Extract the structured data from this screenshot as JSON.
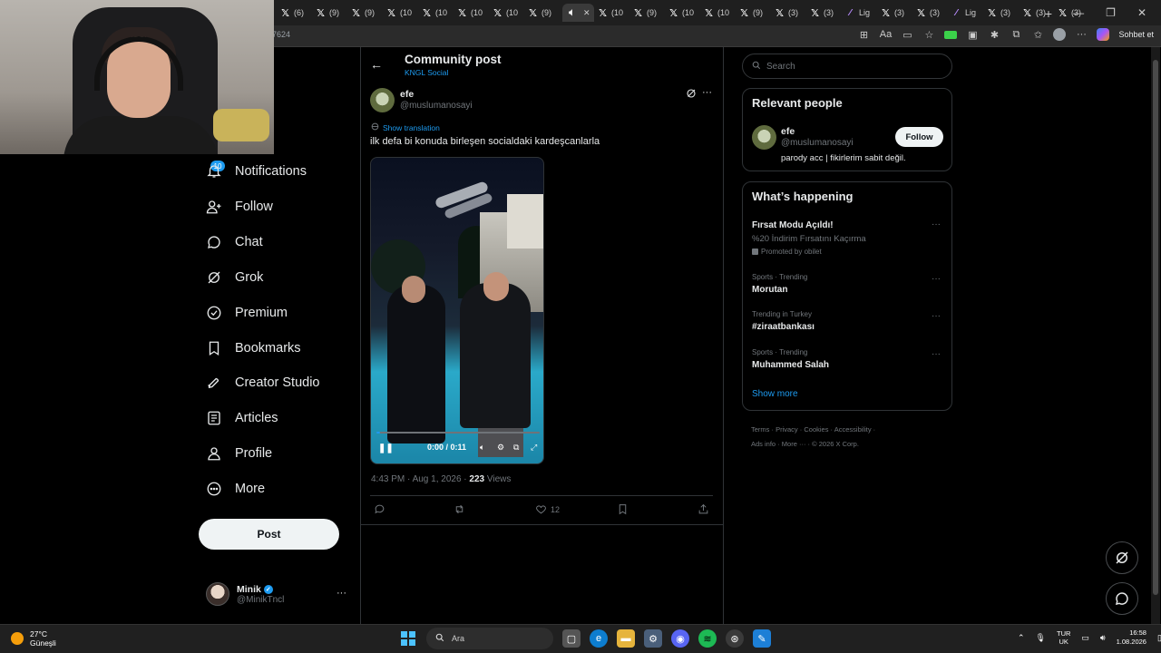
{
  "browser": {
    "tabs": [
      {
        "label": "(6)",
        "active": false
      },
      {
        "label": "(9)",
        "active": false
      },
      {
        "label": "(9)",
        "active": false
      },
      {
        "label": "(10",
        "active": false
      },
      {
        "label": "(10",
        "active": false
      },
      {
        "label": "(10",
        "active": false
      },
      {
        "label": "(10",
        "active": false
      },
      {
        "label": "(9)",
        "active": false
      },
      {
        "label": "",
        "active": true
      },
      {
        "label": "(10",
        "active": false
      },
      {
        "label": "(9)",
        "active": false
      },
      {
        "label": "(10",
        "active": false
      },
      {
        "label": "(10",
        "active": false
      },
      {
        "label": "(9)",
        "active": false
      },
      {
        "label": "(3)",
        "active": false
      },
      {
        "label": "(3)",
        "active": false
      },
      {
        "label": "Lig",
        "active": false
      },
      {
        "label": "(3)",
        "active": false
      },
      {
        "label": "(3)",
        "active": false
      },
      {
        "label": "Lig",
        "active": false
      },
      {
        "label": "(3)",
        "active": false
      },
      {
        "label": "(3)",
        "active": false
      },
      {
        "label": "(3)",
        "active": false
      }
    ],
    "url_fragment": "7624",
    "copilot_label": "Sohbet et"
  },
  "nav": {
    "notifications_badge": "10",
    "items": [
      {
        "label": "Notifications",
        "icon": "bell-icon"
      },
      {
        "label": "Follow",
        "icon": "person-add-icon"
      },
      {
        "label": "Chat",
        "icon": "chat-icon"
      },
      {
        "label": "Grok",
        "icon": "grok-icon"
      },
      {
        "label": "Premium",
        "icon": "premium-icon"
      },
      {
        "label": "Bookmarks",
        "icon": "bookmark-icon"
      },
      {
        "label": "Creator Studio",
        "icon": "rocket-icon"
      },
      {
        "label": "Articles",
        "icon": "article-icon"
      },
      {
        "label": "Profile",
        "icon": "person-icon"
      },
      {
        "label": "More",
        "icon": "more-circle-icon"
      }
    ],
    "post_button": "Post",
    "account": {
      "name": "Minik",
      "handle": "@MinikTncl"
    }
  },
  "header": {
    "title": "Community post",
    "subtitle": "KNGL Social"
  },
  "post": {
    "name": "efe",
    "handle": "@muslumanosayi",
    "show_translation": "Show translation",
    "text": "ilk defa bi konuda birleşen socialdaki kardeşcanlarla",
    "video_time": "0:00 / 0:11",
    "video_progress": 0.02,
    "timestamp": "4:43 PM · Aug 1, 2026 · ",
    "views_count": "223",
    "views_label": " Views",
    "likes": "12"
  },
  "sidebar": {
    "search_placeholder": "Search",
    "relevant_title": "Relevant people",
    "relevant": {
      "name": "efe",
      "handle": "@muslumanosayi",
      "bio": "parody acc | fikirlerim sabit değil.",
      "follow": "Follow"
    },
    "happening_title": "What’s happening",
    "promo": {
      "title": "Fırsat Modu Açıldı!",
      "desc": "%20 İndirim Fırsatını Kaçırma",
      "promoted": "Promoted by obilet"
    },
    "trends": [
      {
        "category": "Sports · Trending",
        "name": "Morutan"
      },
      {
        "category": "Trending in Turkey",
        "name": "#ziraatbankası"
      },
      {
        "category": "Sports · Trending",
        "name": "Muhammed Salah"
      }
    ],
    "show_more": "Show more",
    "footer": [
      "Terms",
      "Privacy",
      "Cookies",
      "Accessibility",
      "Ads info",
      "More ···",
      "© 2026 X Corp."
    ]
  },
  "taskbar": {
    "temp": "27°C",
    "weather": "Güneşli",
    "search": "Ara",
    "lang_top": "TUR",
    "lang_bottom": "UK",
    "time": "16:58",
    "date": "1.08.2026"
  },
  "colors": {
    "accent": "#1d9bf0",
    "background": "#000000",
    "text": "#e7e9ea",
    "muted": "#71767b"
  }
}
